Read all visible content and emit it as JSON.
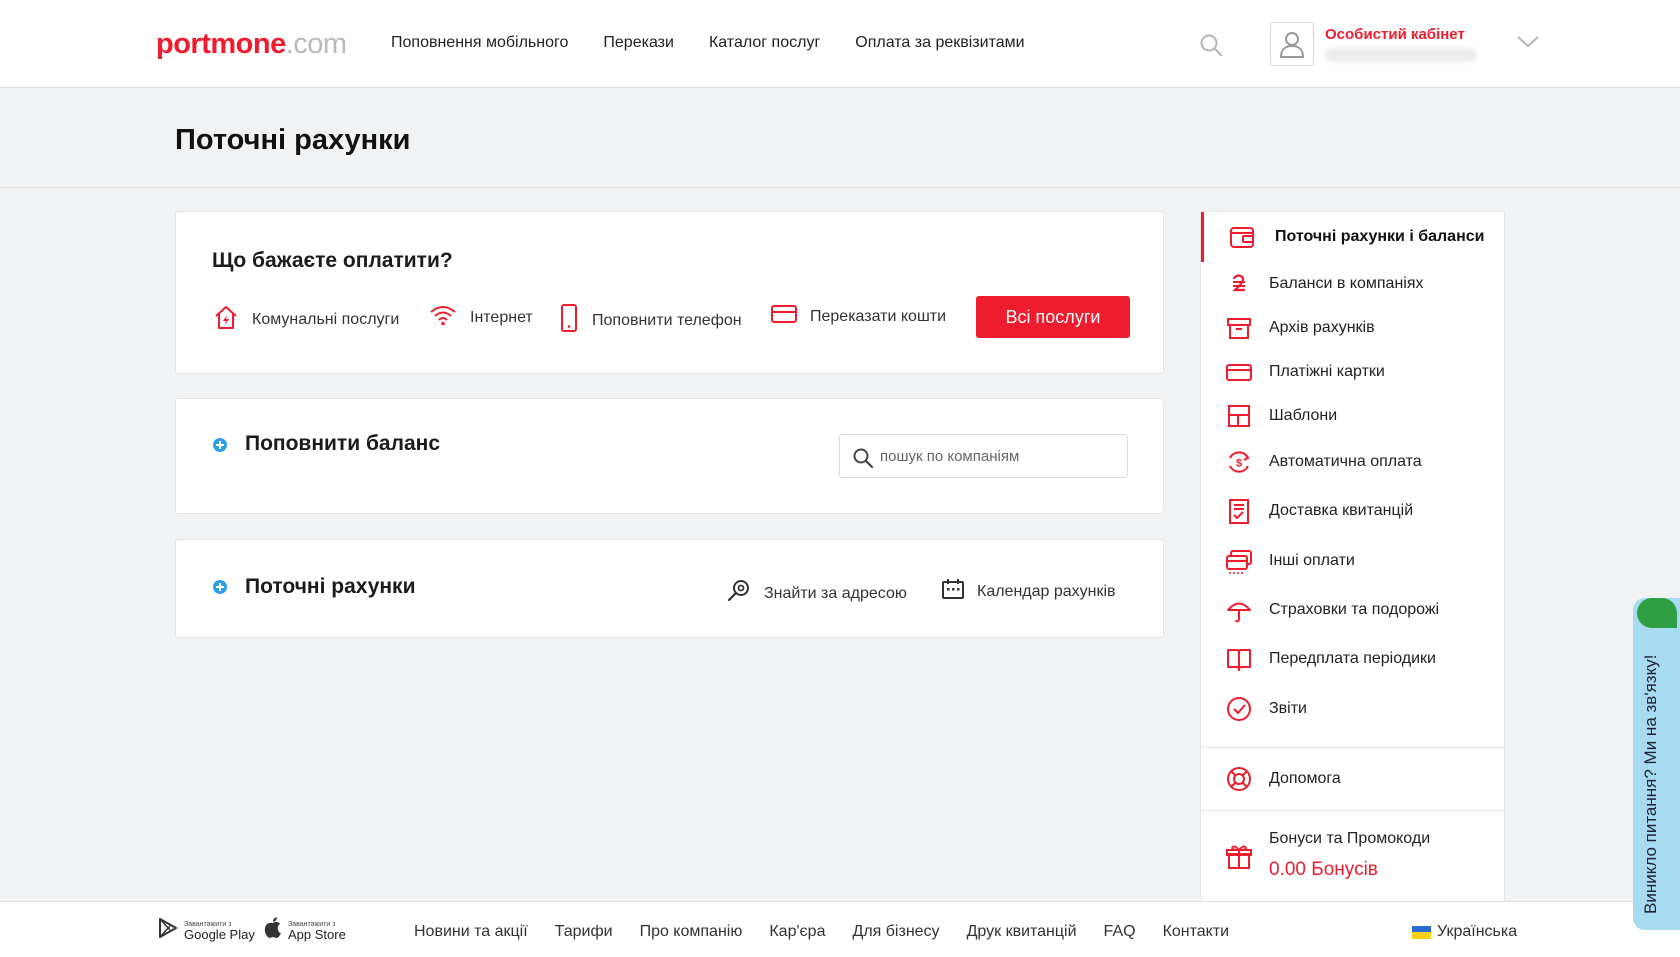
{
  "header": {
    "logo_main": "portmone",
    "logo_domain": ".com",
    "nav": [
      "Поповнення мобільного",
      "Перекази",
      "Каталог послуг",
      "Оплата за реквізитами"
    ],
    "cabinet_title": "Особистий кабінет"
  },
  "page": {
    "title": "Поточні рахунки"
  },
  "pay_card": {
    "title": "Що бажаєте оплатити?",
    "services": [
      "Комунальні послуги",
      "Інтернет",
      "Поповнити телефон",
      "Переказати кошти"
    ],
    "all_button": "Всі послуги"
  },
  "balance_card": {
    "title": "Поповнити баланс",
    "search_placeholder": "пошук по компаніям"
  },
  "accounts_card": {
    "title": "Поточні рахунки",
    "find_by_address": "Знайти за адресою",
    "calendar": "Календар рахунків"
  },
  "sidebar": {
    "items": [
      {
        "label": "Поточні рахунки і баланси",
        "icon": "wallet-icon"
      },
      {
        "label": "Баланси в компаніях",
        "icon": "hryvnia-icon"
      },
      {
        "label": "Архів рахунків",
        "icon": "archive-icon"
      },
      {
        "label": "Платіжні картки",
        "icon": "card-icon"
      },
      {
        "label": "Шаблони",
        "icon": "template-icon"
      },
      {
        "label": "Автоматична оплата",
        "icon": "autopay-icon"
      },
      {
        "label": "Доставка квитанцій",
        "icon": "receipt-icon"
      },
      {
        "label": "Інші оплати",
        "icon": "cards-stack-icon"
      },
      {
        "label": "Страховки та подорожі",
        "icon": "umbrella-icon"
      },
      {
        "label": "Передплата періодики",
        "icon": "book-icon"
      },
      {
        "label": "Звіти",
        "icon": "check-circle-icon"
      }
    ],
    "help": "Допомога",
    "bonus_label": "Бонуси та Промокоди",
    "bonus_value": "0.00 Бонусів"
  },
  "footer": {
    "google_small": "Завантажити з",
    "google_big": "Google Play",
    "apple_small": "Завантажити з",
    "apple_big": "App Store",
    "links": [
      "Новини та акції",
      "Тарифи",
      "Про компанію",
      "Кар'єра",
      "Для бізнесу",
      "Друк квитанцій",
      "FAQ",
      "Контакти"
    ],
    "language": "Українська"
  },
  "feedback": {
    "text": "Виникло питання? Ми на зв'язку!"
  },
  "colors": {
    "accent": "#ee1c2e",
    "info": "#2aa0e8",
    "feedback": "#a7dbf2"
  }
}
